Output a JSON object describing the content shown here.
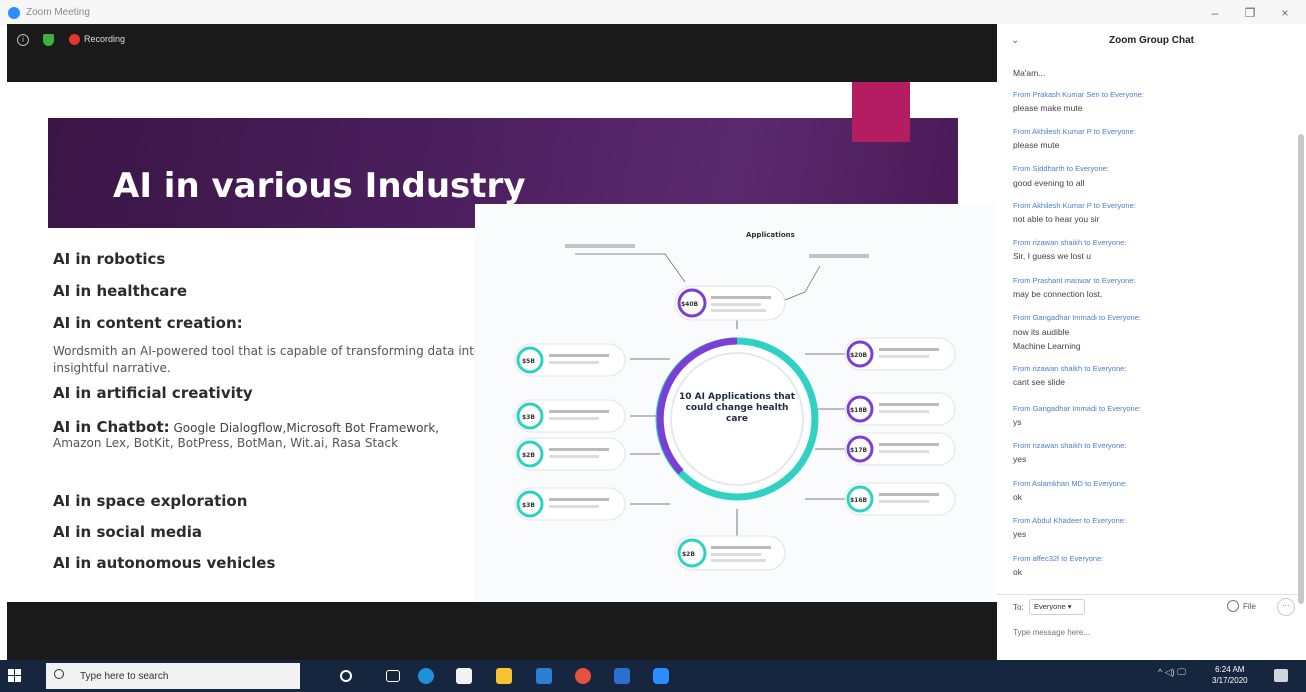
{
  "window": {
    "title": "Zoom Meeting",
    "minimize": "–",
    "maximize": "❐",
    "close": "×"
  },
  "meeting": {
    "recording_label": "Recording"
  },
  "slide": {
    "title": "AI in various Industry",
    "bullets": {
      "b1": "AI in robotics",
      "b2": "AI in healthcare",
      "b3": "AI in content creation:",
      "b3_sub": "Wordsmith an AI-powered tool that is capable of transforming data into insightful narrative.",
      "b4": "AI in artificial creativity",
      "b5": "AI in Chatbot:",
      "b5_sub1": " Google Dialogflow,Microsoft Bot Framework,",
      "b5_sub2": "Amazon Lex, BotKit, BotPress, BotMan, Wit.ai, Rasa Stack",
      "b6": "AI in space exploration",
      "b7": "AI in social media",
      "b8": "AI in autonomous vehicles"
    },
    "infographic": {
      "header": "Applications",
      "center": "10 AI Applications that could change health care",
      "colors": {
        "purple": "#7b3fd6",
        "teal": "#2fd1c4"
      },
      "nodes": {
        "n0": "$40B",
        "n1": "$20B",
        "n2": "$18B",
        "n3": "$17B",
        "n4": "$16B",
        "n5": "$5B",
        "n6": "$3B",
        "n7": "$3B",
        "n8": "$2B",
        "n9": "$2B"
      }
    }
  },
  "chat": {
    "title": "Zoom Group Chat",
    "messages": {
      "m0": {
        "from": "",
        "text": "Ma'am..."
      },
      "m1": {
        "from": "From Prakash Kumar Sen to Everyone:",
        "text": "please make mute"
      },
      "m2": {
        "from": "From Akhilesh Kumar P to Everyone:",
        "text": "please mute"
      },
      "m3": {
        "from": "From Siddharth to Everyone:",
        "text": "good evening to all"
      },
      "m4": {
        "from": "From Akhilesh Kumar P to Everyone:",
        "text": "not able to hear you sir"
      },
      "m5": {
        "from": "From rizawan shaikh to Everyone:",
        "text": "Sir, I guess we lost u"
      },
      "m6": {
        "from": "From Prashant manwar to Everyone:",
        "text": "may be connection lost."
      },
      "m7": {
        "from": "From Gangadhar Immadi to Everyone:",
        "text": "now its audible",
        "text2": "Machine Learning"
      },
      "m8": {
        "from": "From rizawan shaikh to Everyone:",
        "text": "cant see slide"
      },
      "m9": {
        "from": "From Gangadhar Immadi to Everyone:",
        "text": "ys"
      },
      "m10": {
        "from": "From rizawan shaikh to Everyone:",
        "text": "yes"
      },
      "m11": {
        "from": "From Aslamkhan MD to Everyone:",
        "text": "ok"
      },
      "m12": {
        "from": "From Abdul Khadeer to Everyone:",
        "text": "yes"
      },
      "m13": {
        "from": "From affec32f to Everyone:",
        "text": "ok"
      }
    },
    "to_label": "To:",
    "to_value": "Everyone ▾",
    "file_label": "File",
    "more_label": "···",
    "input_placeholder": "Type message here..."
  },
  "taskbar": {
    "search_placeholder": "Type here to search",
    "time": "6:24 AM",
    "date": "3/17/2020",
    "tray": "^ ◁) 🖵"
  }
}
